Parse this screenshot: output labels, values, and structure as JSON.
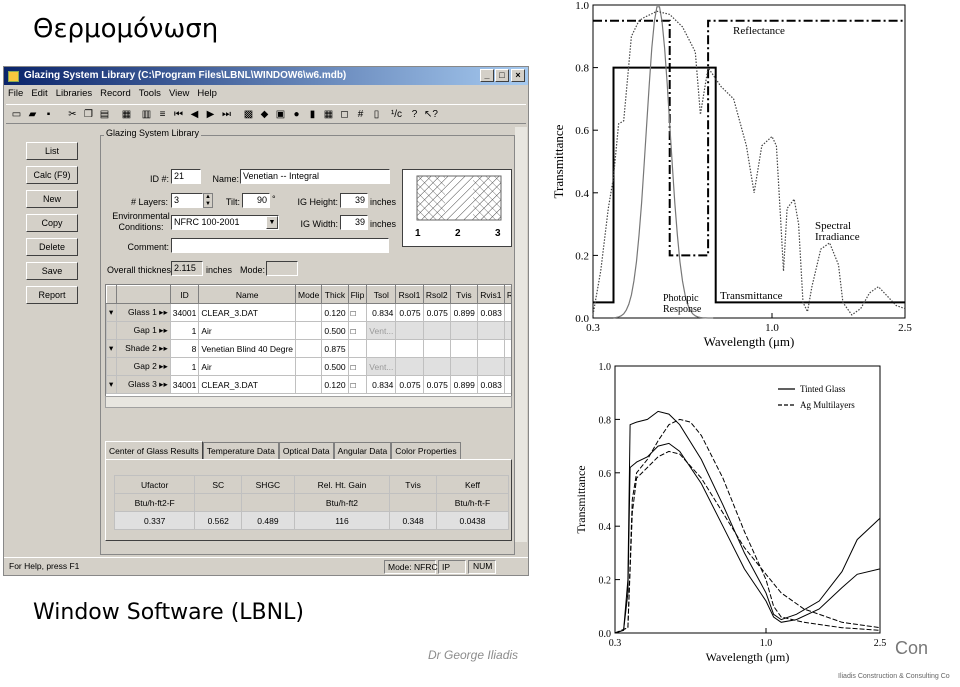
{
  "slide": {
    "title": "Θερμομόνωση",
    "subtitle": "Window Software (LBNL)",
    "author": "Dr George Iliadis",
    "con": "Con",
    "logo": "Iliadis Construction & Consulting Co"
  },
  "window": {
    "title": "Glazing System Library (C:\\Program Files\\LBNL\\WINDOW6\\w6.mdb)",
    "menu": [
      "File",
      "Edit",
      "Libraries",
      "Record",
      "Tools",
      "View",
      "Help"
    ],
    "buttons": [
      "List",
      "Calc (F9)",
      "New",
      "Copy",
      "Delete",
      "Save",
      "Report"
    ],
    "group_title": "Glazing System Library",
    "form": {
      "id_label": "ID #:",
      "id": "21",
      "name_label": "Name:",
      "name": "Venetian -- Integral",
      "layers_label": "# Layers:",
      "layers": "3",
      "tilt_label": "Tilt:",
      "tilt": "90",
      "tilt_unit": "°",
      "igh_label": "IG Height:",
      "igh": "39",
      "igh_unit": "inches",
      "env_label1": "Environmental",
      "env_label2": "Conditions:",
      "env": "NFRC 100-2001",
      "igw_label": "IG Width:",
      "igw": "39",
      "igw_unit": "inches",
      "comment_label": "Comment:",
      "comment": "",
      "thick_label": "Overall thickness:",
      "thick": "2.115",
      "thick_unit": "inches",
      "mode_label": "Mode:",
      "mode": ""
    },
    "preview_labels": [
      "1",
      "2",
      "3"
    ],
    "layers_table": {
      "headers": [
        "",
        "",
        "ID",
        "Name",
        "Mode",
        "Thick",
        "Flip",
        "Tsol",
        "Rsol1",
        "Rsol2",
        "Tvis",
        "Rvis1",
        "R"
      ],
      "rows": [
        [
          "▾",
          "Glass 1 ▸▸",
          "34001",
          "CLEAR_3.DAT",
          "",
          "0.120",
          "□",
          "0.834",
          "0.075",
          "0.075",
          "0.899",
          "0.083",
          ""
        ],
        [
          "",
          "Gap 1 ▸▸",
          "1",
          "Air",
          "",
          "0.500",
          "□",
          "Vent...",
          "",
          "",
          "",
          "",
          ""
        ],
        [
          "▾",
          "Shade 2 ▸▸",
          "8",
          "Venetian Blind 40 Degre",
          "",
          "0.875",
          "",
          "",
          "",
          "",
          "",
          "",
          ""
        ],
        [
          "",
          "Gap 2 ▸▸",
          "1",
          "Air",
          "",
          "0.500",
          "□",
          "Vent...",
          "",
          "",
          "",
          "",
          ""
        ],
        [
          "▾",
          "Glass 3 ▸▸",
          "34001",
          "CLEAR_3.DAT",
          "",
          "0.120",
          "□",
          "0.834",
          "0.075",
          "0.075",
          "0.899",
          "0.083",
          ""
        ]
      ]
    },
    "tabs": [
      "Center of Glass Results",
      "Temperature Data",
      "Optical Data",
      "Angular Data",
      "Color Properties"
    ],
    "results": {
      "headers": [
        "Ufactor",
        "SC",
        "SHGC",
        "Rel. Ht. Gain",
        "Tvis",
        "Keff"
      ],
      "units": [
        "Btu/h-ft2-F",
        "",
        "",
        "Btu/h-ft2",
        "",
        "Btu/h-ft-F"
      ],
      "values": [
        "0.337",
        "0.562",
        "0.489",
        "116",
        "0.348",
        "0.0438"
      ]
    },
    "status": {
      "help": "For Help, press F1",
      "mode": "Mode: NFRC",
      "ip": "IP",
      "num": "NUM"
    }
  },
  "chart_data": [
    {
      "type": "line",
      "xlabel": "Wavelength (μm)",
      "ylabel": "Transmittance",
      "ylim": [
        0,
        1
      ],
      "yticks": [
        "0.0",
        "0.2",
        "0.4",
        "0.6",
        "0.8",
        "1.0"
      ],
      "xticks": [
        "0.3",
        "1.0",
        "2.5"
      ],
      "annotations": [
        "Reflectance",
        "Spectral Irradiance",
        "Transmittance",
        "Photopic Response"
      ],
      "series": [
        {
          "name": "Transmittance",
          "x": [
            0.3,
            0.38,
            0.38,
            0.78,
            0.78,
            2.5
          ],
          "y": [
            0.05,
            0.05,
            0.8,
            0.8,
            0.05,
            0.05
          ]
        },
        {
          "name": "Reflectance",
          "x": [
            0.3,
            0.6,
            0.6,
            0.75,
            0.75,
            2.5
          ],
          "y": [
            0.95,
            0.95,
            0.2,
            0.2,
            0.95,
            0.95
          ]
        }
      ]
    },
    {
      "type": "line",
      "xlabel": "Wavelength (μm)",
      "ylabel": "Transmittance",
      "ylim": [
        0,
        1
      ],
      "yticks": [
        "0.0",
        "0.2",
        "0.4",
        "0.6",
        "0.8",
        "1.0"
      ],
      "xticks": [
        "0.3",
        "1.0",
        "2.5"
      ],
      "legend": [
        "Tinted Glass",
        "Ag Multilayers"
      ]
    }
  ]
}
